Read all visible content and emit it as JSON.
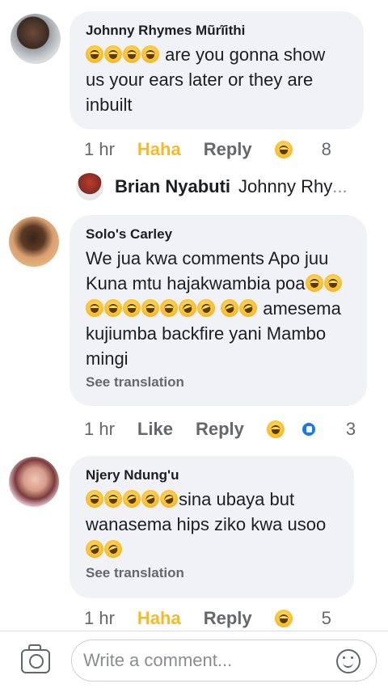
{
  "comments": [
    {
      "author": "Johnny Rhymes Mũrĩithi",
      "text": "are you gonna show us your ears later or they are inbuilt",
      "time": "1 hr",
      "reaction_label": "Haha",
      "reply_label": "Reply",
      "reaction_count": "8"
    },
    {
      "author": "Solo's Carley",
      "text_line1": "We jua kwa comments Apo juu Kuna mtu hajakwambia",
      "text_poa": "poa",
      "text_line2": "amesema kujiumba backfire yani Mambo mingi",
      "see_translation": "See translation",
      "time": "1 hr",
      "reaction_label": "Like",
      "reply_label": "Reply",
      "reaction_count": "3"
    },
    {
      "author": "Njery Ndung'u",
      "text_line1": "sina ubaya but wanasema hips ziko kwa",
      "text_usoo": "usoo",
      "see_translation": "See translation",
      "time": "1 hr",
      "reaction_label": "Haha",
      "reply_label": "Reply",
      "reaction_count": "5"
    }
  ],
  "reply_preview": {
    "name": "Brian Nyabuti",
    "text": "Johnny Rhy",
    "ellipsis": "..."
  },
  "composer": {
    "placeholder": "Write a comment..."
  },
  "icons": [
    "camera-icon",
    "emoji-icon",
    "haha-reaction-icon",
    "like-reaction-icon"
  ],
  "colors": {
    "haha": "#f7b928",
    "bubble": "#f0f2f5",
    "meta": "#65676b",
    "like_blue": "#1877f2"
  }
}
